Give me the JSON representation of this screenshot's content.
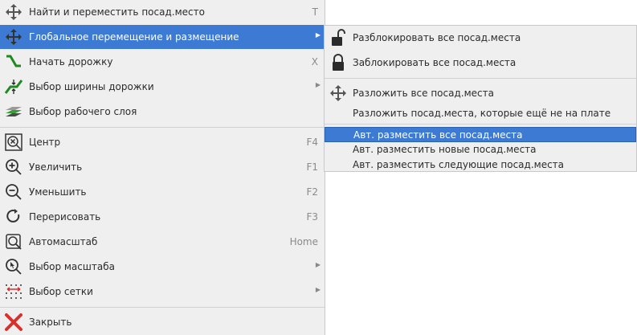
{
  "main_menu": {
    "items": [
      {
        "label": "Найти и переместить посад.место",
        "shortcut": "T",
        "icon": "move-icon"
      },
      {
        "label": "Глобальное перемещение и размещение",
        "icon": "move-icon"
      },
      {
        "label": "Начать дорожку",
        "shortcut": "X",
        "icon": "track-icon"
      },
      {
        "label": "Выбор ширины дорожки",
        "icon": "track-width-icon"
      },
      {
        "label": "Выбор рабочего слоя",
        "icon": "layers-icon"
      },
      {
        "label": "Центр",
        "shortcut": "F4",
        "icon": "zoom-center-icon"
      },
      {
        "label": "Увеличить",
        "shortcut": "F1",
        "icon": "zoom-in-icon"
      },
      {
        "label": "Уменьшить",
        "shortcut": "F2",
        "icon": "zoom-out-icon"
      },
      {
        "label": "Перерисовать",
        "shortcut": "F3",
        "icon": "redraw-icon"
      },
      {
        "label": "Автомасштаб",
        "shortcut": "Home",
        "icon": "zoom-fit-icon"
      },
      {
        "label": "Выбор масштаба",
        "icon": "zoom-select-icon"
      },
      {
        "label": "Выбор сетки",
        "icon": "grid-icon"
      },
      {
        "label": "Закрыть",
        "icon": "close-icon"
      }
    ]
  },
  "sub_menu": {
    "items": [
      {
        "label": "Разблокировать все посад.места",
        "icon": "unlock-icon"
      },
      {
        "label": "Заблокировать все посад.места",
        "icon": "lock-icon"
      },
      {
        "label": "Разложить все посад.места",
        "icon": "move-icon"
      },
      {
        "label": "Разложить посад.места, которые ещё не на плате"
      },
      {
        "label": "Авт. разместить все посад.места"
      },
      {
        "label": "Авт. разместить новые посад.места"
      },
      {
        "label": "Авт. разместить следующие посад.места"
      }
    ]
  },
  "colors": {
    "highlight": "#3d7ad3",
    "menu_bg": "#efefef",
    "track_green": "#1f8a1f",
    "close_red": "#d8302c"
  }
}
